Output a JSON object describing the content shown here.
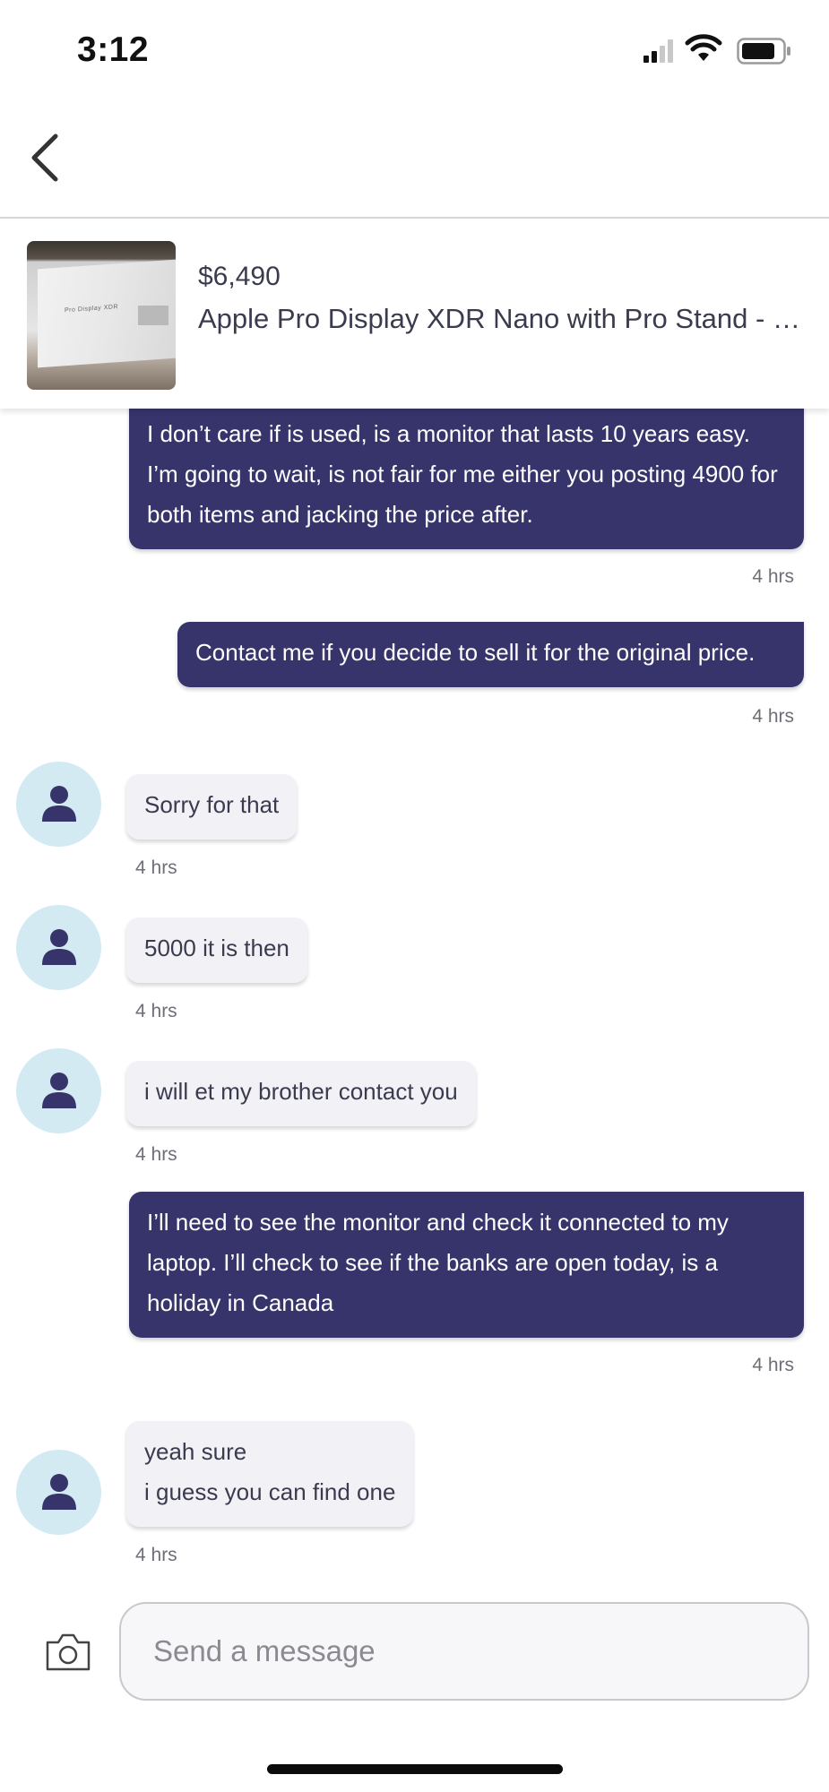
{
  "status_bar": {
    "time": "3:12"
  },
  "listing": {
    "price": "$6,490",
    "title": "Apple Pro Display XDR Nano with Pro Stand - N...",
    "thumbnail_text": "Pro Display XDR"
  },
  "messages": [
    {
      "sender": "me",
      "text": "I don’t care if is used, is a monitor that lasts 10 years easy. I’m going to wait, is not fair for me either you posting 4900 for both items and jacking the price after.",
      "time": "4 hrs"
    },
    {
      "sender": "me",
      "text": "Contact me if you decide to sell it for the original price.",
      "time": "4 hrs"
    },
    {
      "sender": "other",
      "text": "Sorry for that",
      "time": "4 hrs"
    },
    {
      "sender": "other",
      "text": "5000 it is then",
      "time": "4 hrs"
    },
    {
      "sender": "other",
      "text": "i will et my brother contact you",
      "time": "4 hrs"
    },
    {
      "sender": "me",
      "text": "I’ll need to see the monitor and check it connected to my laptop. I’ll check to see if the banks are open today, is a holiday in Canada",
      "time": "4 hrs"
    },
    {
      "sender": "other",
      "lines": [
        "yeah sure",
        "i guess you can find one"
      ],
      "time": "4 hrs"
    }
  ],
  "composer": {
    "placeholder": "Send a message"
  },
  "icons": {
    "back": "chevron-left-icon",
    "camera": "camera-icon",
    "avatar": "person-icon",
    "signal": "signal-icon",
    "wifi": "wifi-icon",
    "battery": "battery-icon"
  },
  "colors": {
    "outgoing_bubble": "#37346b",
    "incoming_bubble": "#f2f2f6",
    "avatar_bg": "#d4eaf3"
  }
}
